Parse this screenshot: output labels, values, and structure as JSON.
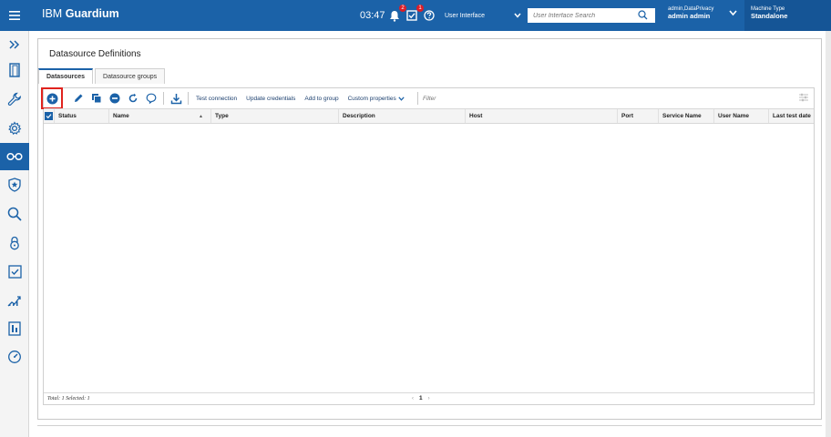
{
  "header": {
    "brand_prefix": "IBM",
    "brand_name": "Guardium",
    "time": "03:47",
    "notifications_count": "2",
    "tasks_count": "1",
    "interface_select": "User Interface",
    "search_placeholder": "User Interface Search",
    "user_role": "admin,DataPrivacy",
    "user_name": "admin admin",
    "machine_type_label": "Machine Type",
    "machine_type_value": "Standalone"
  },
  "leftnav": {
    "items": [
      "expand-icon",
      "door-icon",
      "wrench-icon",
      "gear-icon",
      "glasses-icon",
      "shield-icon",
      "search-icon",
      "lock-icon",
      "checklist-icon",
      "chart-icon",
      "report-icon",
      "gauge-icon"
    ],
    "active_index": 4
  },
  "panel": {
    "title": "Datasource Definitions",
    "tabs": [
      {
        "label": "Datasources",
        "active": true
      },
      {
        "label": "Datasource groups",
        "active": false
      }
    ]
  },
  "toolbar": {
    "test_connection": "Test connection",
    "update_credentials": "Update credentials",
    "add_to_group": "Add to group",
    "custom_properties": "Custom properties",
    "filter_placeholder": "Filter"
  },
  "table": {
    "columns": [
      "Status",
      "Name",
      "Type",
      "Description",
      "Host",
      "Port",
      "Service Name",
      "User Name",
      "Last test date"
    ]
  },
  "footer": {
    "total": "Total: 1 Selected: 1",
    "page": "1"
  },
  "colors": {
    "primary": "#1b62a8",
    "highlight": "#e0231e",
    "badge": "#da1e28"
  }
}
